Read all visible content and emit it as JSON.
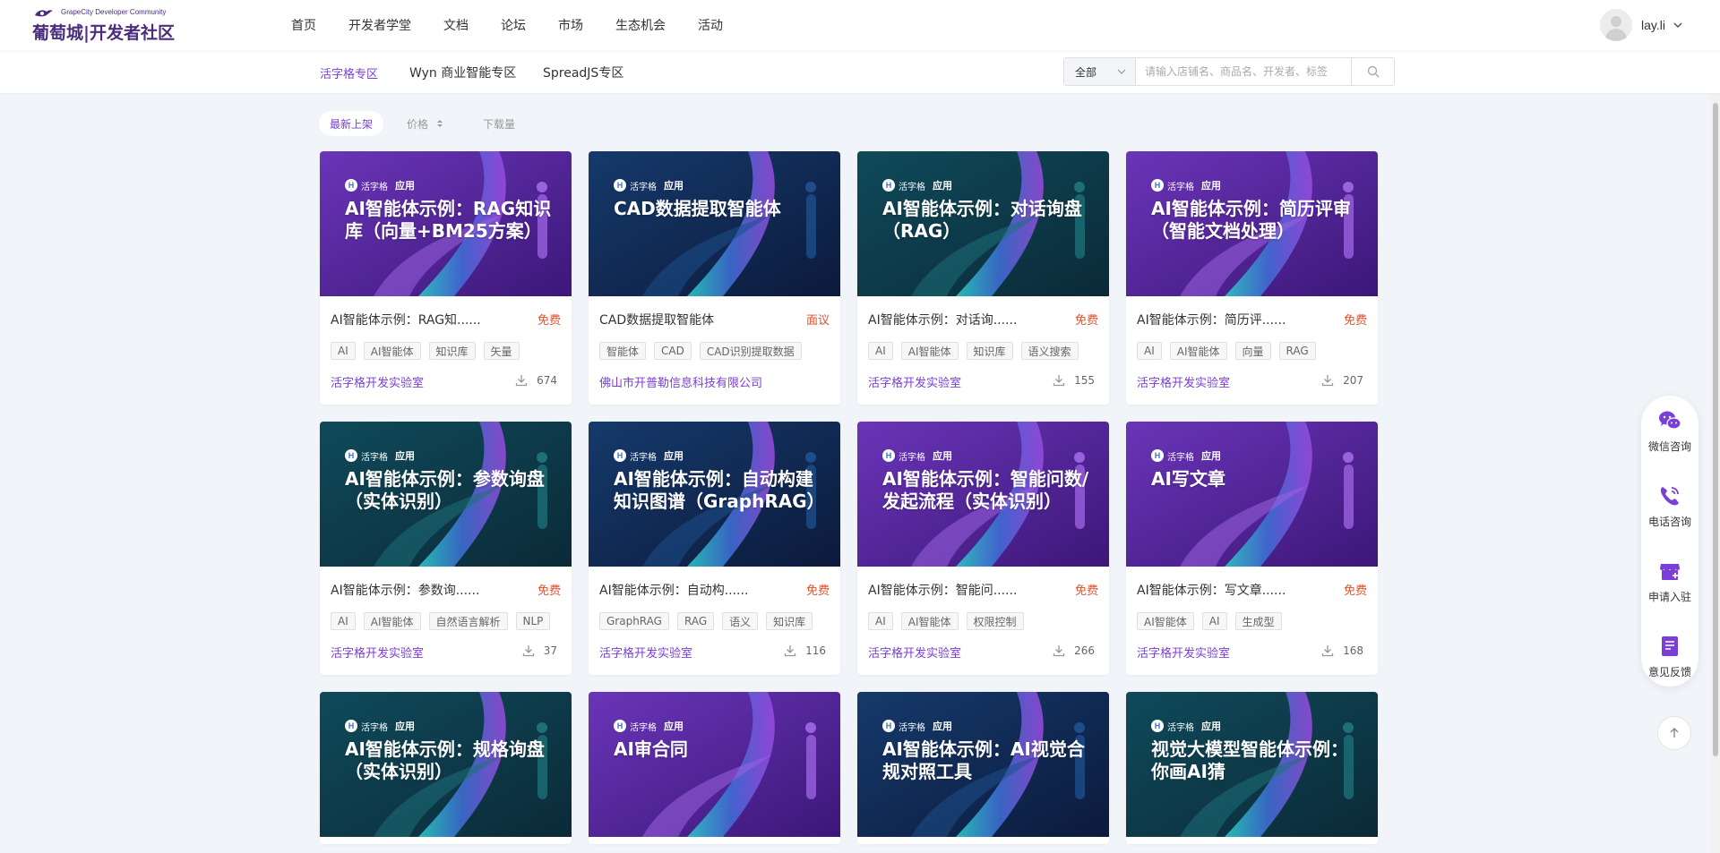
{
  "header": {
    "logo_sub": "GrapeCity Developer Community",
    "logo_main": "葡萄城|开发者社区",
    "nav": [
      "首页",
      "开发者学堂",
      "文档",
      "论坛",
      "市场",
      "生态机会",
      "活动"
    ],
    "username": "lay.li"
  },
  "subnav": {
    "tabs": [
      "活字格专区",
      "Wyn 商业智能专区",
      "SpreadJS专区"
    ],
    "active_tab": 0
  },
  "search": {
    "scope": "全部",
    "placeholder": "请输入店铺名、商品名、开发者、标签"
  },
  "sort": {
    "options": [
      "最新上架",
      "价格",
      "下载量"
    ]
  },
  "colors": {
    "accent": "#7b3fd6",
    "price": "#e2502b",
    "banner_purple": "#5a2a9e",
    "banner_teal": "#0f4a5a",
    "banner_blue": "#153a6b"
  },
  "badge": {
    "brand": "活字格",
    "label": "应用"
  },
  "cards": [
    {
      "banner_title": "AI智能体示例：RAG知识库（向量+BM25方案）",
      "title": "AI智能体示例：RAG知......",
      "price": "免费",
      "tags": [
        "AI",
        "AI智能体",
        "知识库",
        "矢量"
      ],
      "vendor": "活字格开发实验室",
      "downloads": "674",
      "theme": "purple"
    },
    {
      "banner_title": "CAD数据提取智能体",
      "title": "CAD数据提取智能体",
      "price": "面议",
      "tags": [
        "智能体",
        "CAD",
        "CAD识别提取数据"
      ],
      "vendor": "佛山市开普勒信息科技有限公司",
      "downloads": "",
      "theme": "blue"
    },
    {
      "banner_title": "AI智能体示例：对话询盘（RAG）",
      "title": "AI智能体示例：对话询......",
      "price": "免费",
      "tags": [
        "AI",
        "AI智能体",
        "知识库",
        "语义搜索"
      ],
      "vendor": "活字格开发实验室",
      "downloads": "155",
      "theme": "teal"
    },
    {
      "banner_title": "AI智能体示例：简历评审（智能文档处理）",
      "title": "AI智能体示例：简历评......",
      "price": "免费",
      "tags": [
        "AI",
        "AI智能体",
        "向量",
        "RAG"
      ],
      "vendor": "活字格开发实验室",
      "downloads": "207",
      "theme": "purple"
    },
    {
      "banner_title": "AI智能体示例：参数询盘（实体识别）",
      "title": "AI智能体示例：参数询......",
      "price": "免费",
      "tags": [
        "AI",
        "AI智能体",
        "自然语言解析",
        "NLP"
      ],
      "vendor": "活字格开发实验室",
      "downloads": "37",
      "theme": "teal"
    },
    {
      "banner_title": "AI智能体示例：自动构建知识图谱（GraphRAG）",
      "title": "AI智能体示例：自动构......",
      "price": "免费",
      "tags": [
        "GraphRAG",
        "RAG",
        "语义",
        "知识库"
      ],
      "vendor": "活字格开发实验室",
      "downloads": "116",
      "theme": "blue"
    },
    {
      "banner_title": "AI智能体示例：智能问数/发起流程（实体识别）",
      "title": "AI智能体示例：智能问......",
      "price": "免费",
      "tags": [
        "AI",
        "AI智能体",
        "权限控制"
      ],
      "vendor": "活字格开发实验室",
      "downloads": "266",
      "theme": "purple"
    },
    {
      "banner_title": "AI写文章",
      "title": "AI智能体示例：写文章......",
      "price": "免费",
      "tags": [
        "AI智能体",
        "AI",
        "生成型"
      ],
      "vendor": "活字格开发实验室",
      "downloads": "168",
      "theme": "purple"
    },
    {
      "banner_title": "AI智能体示例：规格询盘（实体识别）",
      "theme": "teal"
    },
    {
      "banner_title": "AI审合同",
      "theme": "purple"
    },
    {
      "banner_title": "AI智能体示例：AI视觉合规对照工具",
      "theme": "blue"
    },
    {
      "banner_title": "视觉大模型智能体示例：你画AI猜",
      "theme": "teal"
    }
  ],
  "float_bar": [
    "微信咨询",
    "电话咨询",
    "申请入驻",
    "意见反馈"
  ]
}
